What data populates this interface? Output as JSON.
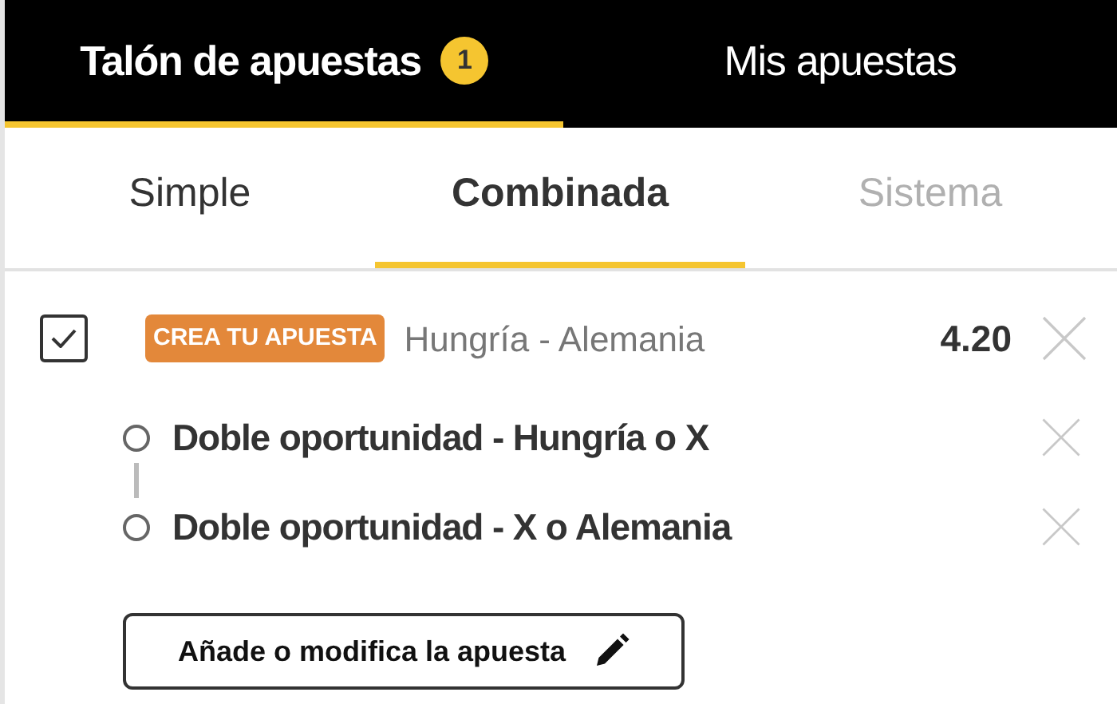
{
  "main_tabs": [
    {
      "label": "Talón de apuestas",
      "badge": "1",
      "selected": true
    },
    {
      "label": "Mis apuestas",
      "selected": false
    }
  ],
  "bet_types": [
    {
      "label": "Simple",
      "selected": false,
      "disabled": false
    },
    {
      "label": "Combinada",
      "selected": true,
      "disabled": false
    },
    {
      "label": "Sistema",
      "selected": false,
      "disabled": true
    }
  ],
  "selection": {
    "checked": true,
    "tag": "CREA TU APUESTA",
    "event": "Hungría - Alemania",
    "odds": "4.20",
    "legs": [
      {
        "label": "Doble oportunidad - Hungría o X"
      },
      {
        "label": "Doble oportunidad - X o Alemania"
      }
    ]
  },
  "edit_button": "Añade o modifica la apuesta"
}
